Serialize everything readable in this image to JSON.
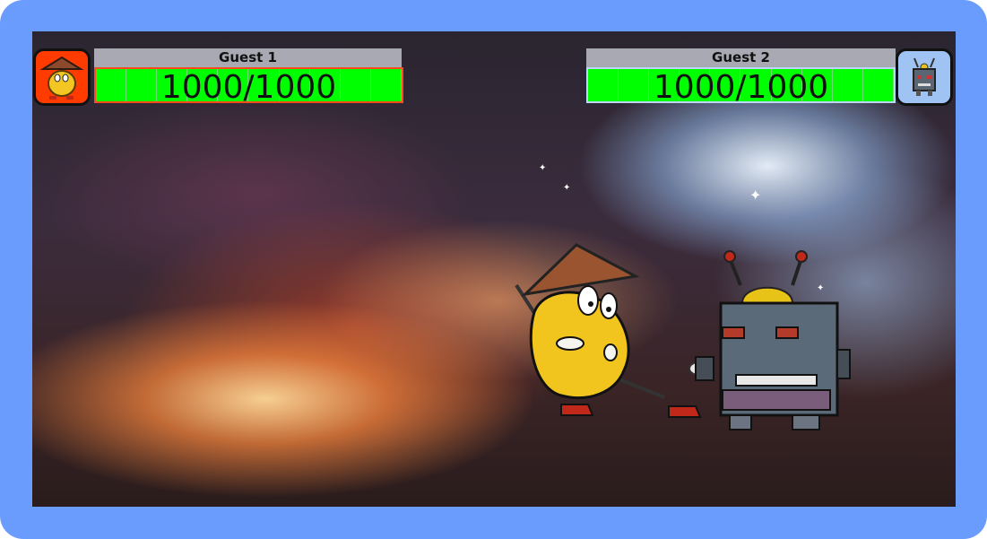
{
  "players": [
    {
      "name": "Guest 1",
      "hp_text": "1000/1000",
      "hp_fraction": 1.0,
      "hp_segments": 10,
      "portrait": "potato-samurai-icon",
      "portrait_bg": "#ff3b00",
      "bar_border": "#ff4a1c"
    },
    {
      "name": "Guest 2",
      "hp_text": "1000/1000",
      "hp_fraction": 1.0,
      "hp_segments": 10,
      "portrait": "robot-icon",
      "portrait_bg": "#9fc3f2",
      "bar_border": "#bcd7ff"
    }
  ],
  "colors": {
    "frame": "#6a9cfd",
    "hp_fill": "#00ff00"
  },
  "scene": {
    "background": "space-nebula",
    "fighters": [
      "potato-samurai",
      "robot"
    ]
  }
}
